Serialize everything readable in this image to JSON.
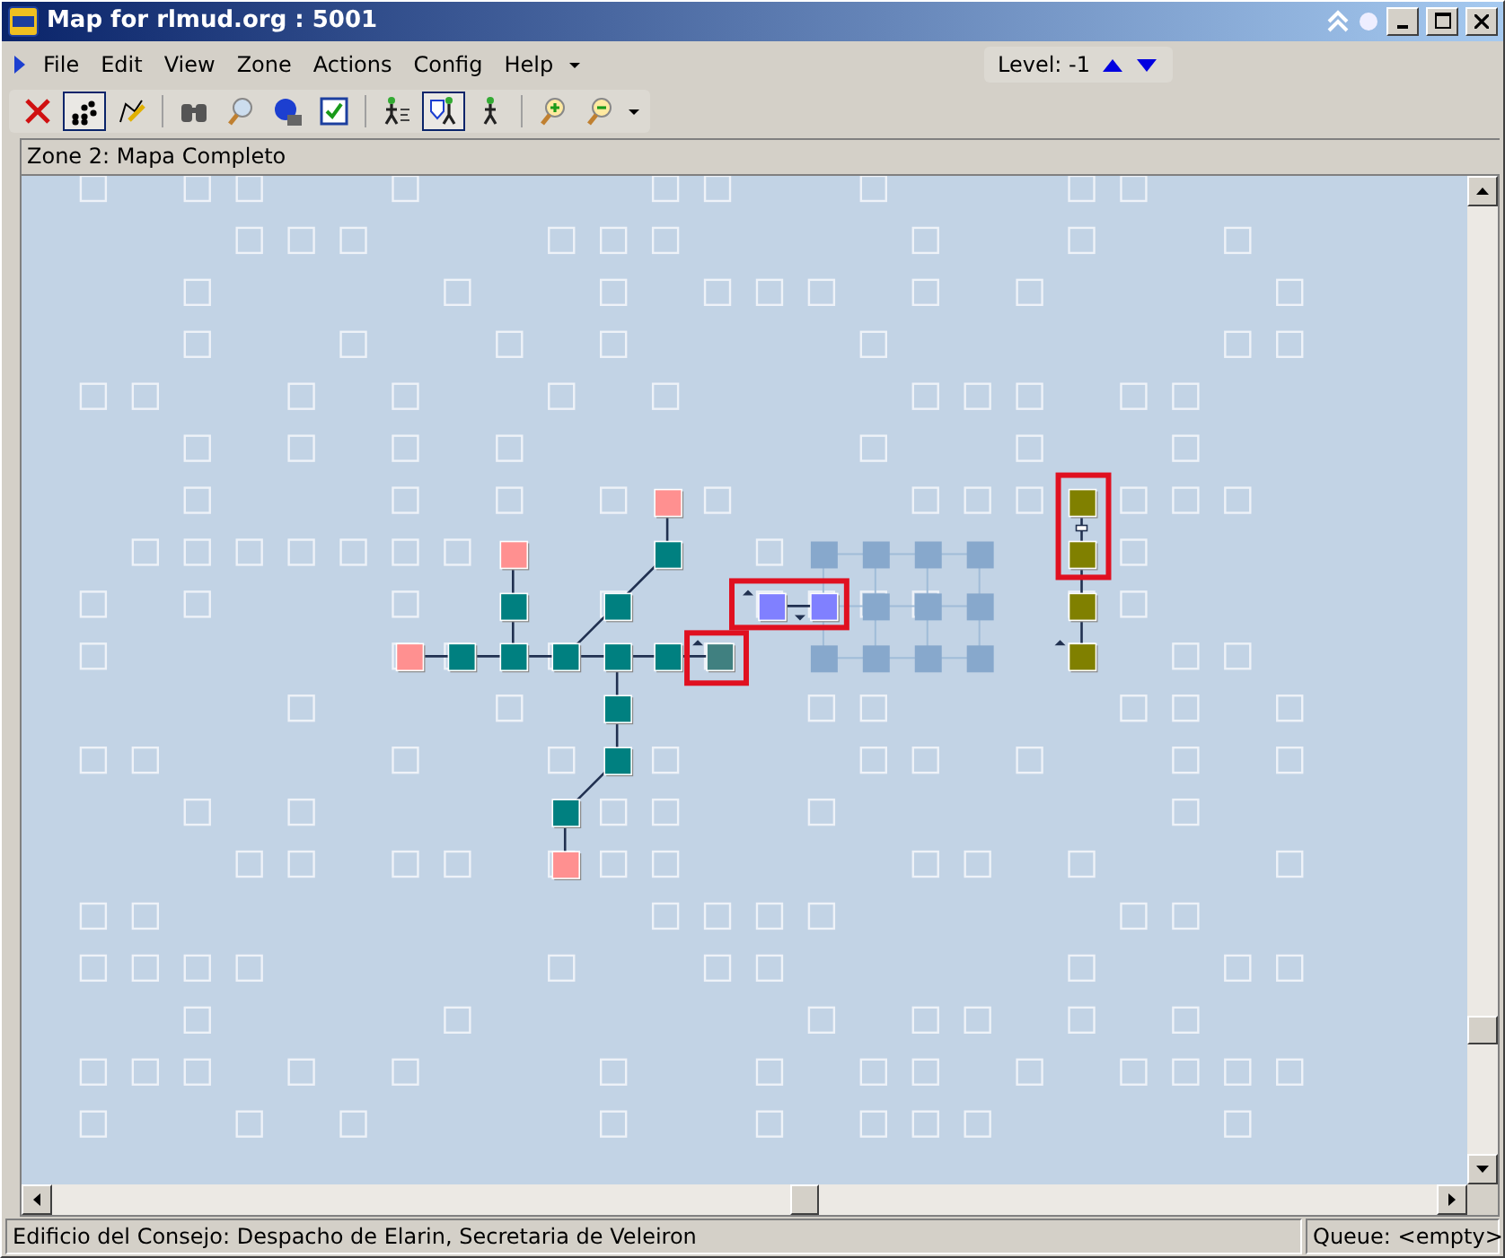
{
  "window": {
    "title": "Map for rlmud.org : 5001"
  },
  "menu": [
    {
      "label": "File"
    },
    {
      "label": "Edit"
    },
    {
      "label": "View"
    },
    {
      "label": "Zone"
    },
    {
      "label": "Actions"
    },
    {
      "label": "Config"
    },
    {
      "label": "Help"
    }
  ],
  "level_bar": {
    "label": "Level: -1"
  },
  "toolbar": [
    {
      "kind": "delete",
      "selected": false
    },
    {
      "kind": "rooms",
      "selected": true
    },
    {
      "kind": "edit",
      "selected": false
    },
    {
      "kind": "sep"
    },
    {
      "kind": "binoculars",
      "selected": false
    },
    {
      "kind": "magnifier",
      "selected": false
    },
    {
      "kind": "globe",
      "selected": false
    },
    {
      "kind": "check",
      "selected": false
    },
    {
      "kind": "sep"
    },
    {
      "kind": "walk-fast",
      "selected": false
    },
    {
      "kind": "walk-shield",
      "selected": true
    },
    {
      "kind": "walk",
      "selected": false
    },
    {
      "kind": "sep"
    },
    {
      "kind": "zoom-in",
      "selected": false
    },
    {
      "kind": "zoom-out",
      "selected": false
    }
  ],
  "zone_label": "Zone 2: Mapa Completo",
  "status_bar": {
    "room": "Edificio del Consejo: Despacho de Elarin, Secretaria de Veleiron",
    "queue": "Queue: <empty>"
  }
}
